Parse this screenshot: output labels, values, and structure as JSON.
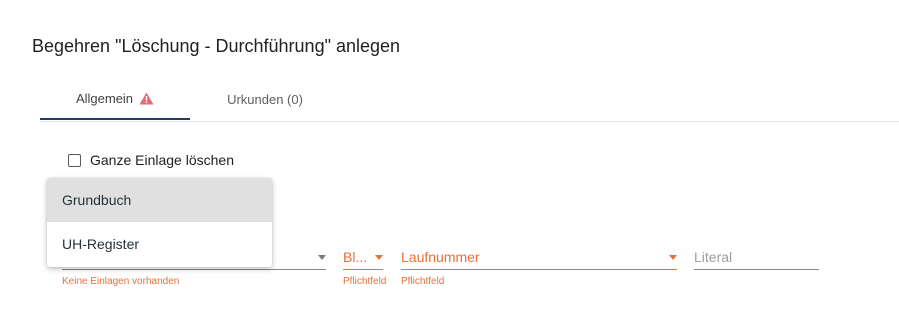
{
  "page": {
    "title": "Begehren \"Löschung - Durchführung\" anlegen"
  },
  "tabs": [
    {
      "label": "Allgemein",
      "icon": "warning-icon",
      "active": true
    },
    {
      "label": "Urkunden (0)",
      "active": false
    }
  ],
  "form": {
    "checkbox_label": "Ganze Einlage löschen",
    "checkbox_checked": false,
    "grundbuch_hint": "Keine Einlagen vorhanden",
    "blatt_value": "Bl...",
    "blatt_hint": "Pflichtfeld",
    "laufnummer_value": "Laufnummer",
    "laufnummer_hint": "Pflichtfeld",
    "literal_placeholder": "Literal"
  },
  "dropdown": {
    "options": [
      {
        "label": "Grundbuch",
        "selected": true
      },
      {
        "label": "UH-Register",
        "selected": false
      }
    ]
  },
  "colors": {
    "error": "#e8703a",
    "warning": "#e06b7a",
    "active_tab_underline": "#1f3f5f"
  }
}
